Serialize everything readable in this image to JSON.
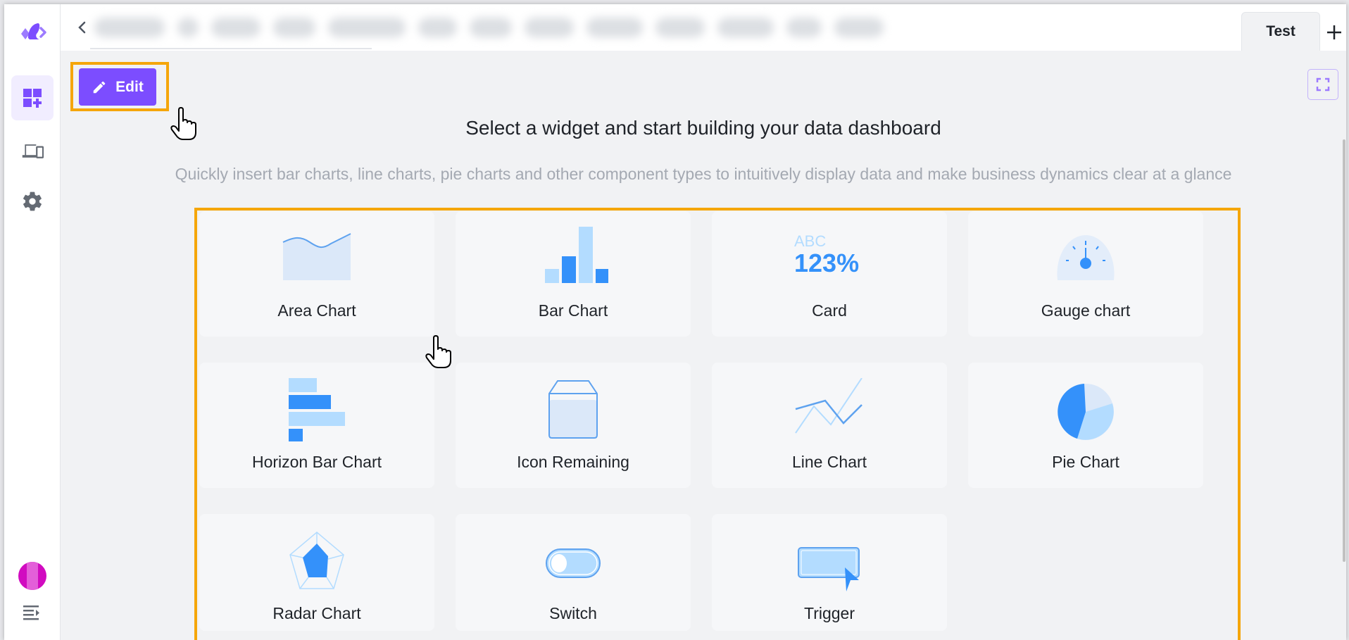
{
  "app": {
    "accent_color": "#7c4dff",
    "highlight_color": "#f5a60a",
    "icon_blue": "#3491fa",
    "icon_light_blue": "#b3dcff"
  },
  "sidebar": {
    "items": [
      {
        "name": "dashboard-add",
        "icon": "dashboard-add-icon",
        "active": true
      },
      {
        "name": "devices",
        "icon": "devices-icon",
        "active": false
      },
      {
        "name": "settings",
        "icon": "gear-icon",
        "active": false
      }
    ],
    "avatar_color": "#d10bc0",
    "collapse_icon": "collapse-menu-icon"
  },
  "tabbar": {
    "back_icon": "chevron-left-icon",
    "redacted_tab_count": 14,
    "active_tab": "Test",
    "add_icon": "plus-icon"
  },
  "toolbar": {
    "edit_label": "Edit",
    "edit_icon": "pencil-icon",
    "fullscreen_icon": "fullscreen-icon"
  },
  "main": {
    "title": "Select a widget and start building your data dashboard",
    "subtitle": "Quickly insert bar charts, line charts, pie charts and other component types to intuitively display data and make business dynamics clear at a glance",
    "widgets": [
      {
        "label": "Area Chart",
        "icon": "area-chart-icon"
      },
      {
        "label": "Bar Chart",
        "icon": "bar-chart-icon"
      },
      {
        "label": "Card",
        "icon": "card-icon",
        "icon_text_top": "ABC",
        "icon_text_main": "123%"
      },
      {
        "label": "Gauge chart",
        "icon": "gauge-chart-icon"
      },
      {
        "label": "Horizon Bar Chart",
        "icon": "horizontal-bar-chart-icon"
      },
      {
        "label": "Icon Remaining",
        "icon": "icon-remaining-icon"
      },
      {
        "label": "Line Chart",
        "icon": "line-chart-icon"
      },
      {
        "label": "Pie Chart",
        "icon": "pie-chart-icon"
      },
      {
        "label": "Radar Chart",
        "icon": "radar-chart-icon"
      },
      {
        "label": "Switch",
        "icon": "switch-icon"
      },
      {
        "label": "Trigger",
        "icon": "trigger-icon"
      }
    ]
  }
}
